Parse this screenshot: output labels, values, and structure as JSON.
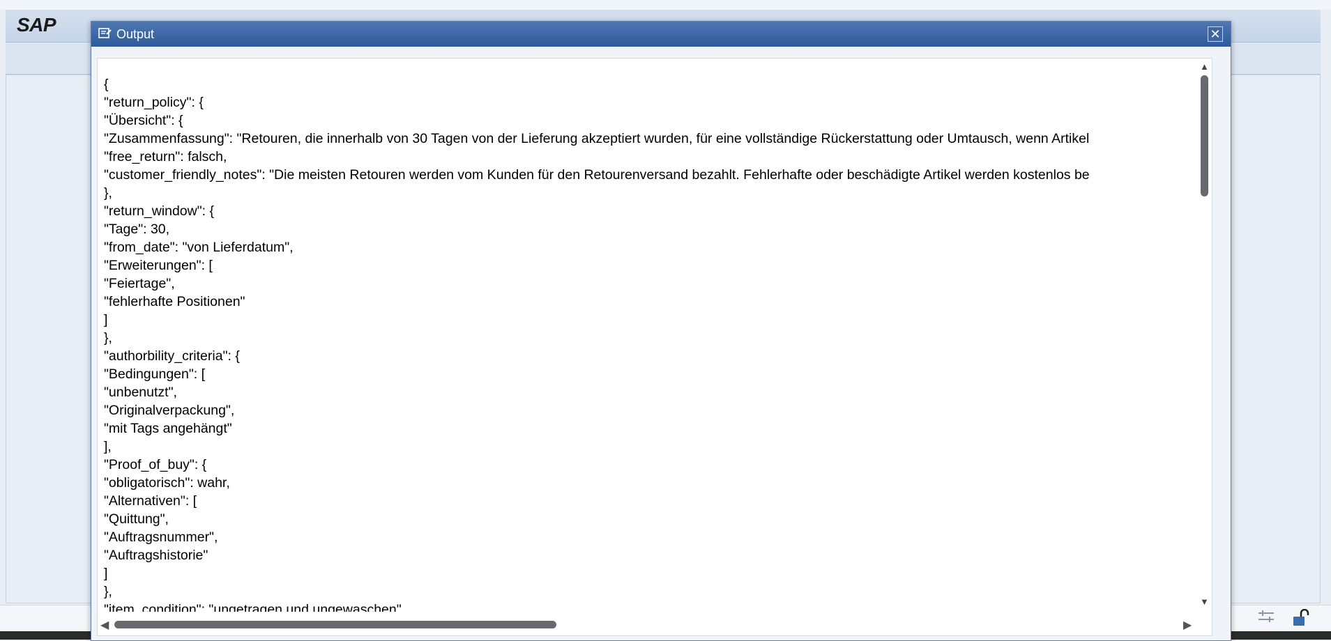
{
  "shell": {
    "logo": "SAP"
  },
  "dialog": {
    "title": "Output",
    "close_label": "✕"
  },
  "output": {
    "lines": [
      "{",
      "\"return_policy\": {",
      "\"Übersicht\": {",
      "\"Zusammenfassung\": \"Retouren, die innerhalb von 30 Tagen von der Lieferung akzeptiert wurden, für eine vollständige Rückerstattung oder Umtausch, wenn Artikel",
      "\"free_return\": falsch,",
      "\"customer_friendly_notes\": \"Die meisten Retouren werden vom Kunden für den Retourenversand bezahlt. Fehlerhafte oder beschädigte Artikel werden kostenlos be",
      "},",
      "\"return_window\": {",
      "\"Tage\": 30,",
      "\"from_date\": \"von Lieferdatum\",",
      "\"Erweiterungen\": [",
      "\"Feiertage\",",
      "\"fehlerhafte Positionen\"",
      "]",
      "},",
      "\"authorbility_criteria\": {",
      "\"Bedingungen\": [",
      "\"unbenutzt\",",
      "\"Originalverpackung\",",
      "\"mit Tags angehängt\"",
      "],",
      "\"Proof_of_buy\": {",
      "\"obligatorisch\": wahr,",
      "\"Alternativen\": [",
      "\"Quittung\",",
      "\"Auftragsnummer\",",
      "\"Auftragshistorie\"",
      "]",
      "},",
      "\"item_condition\": \"ungetragen und ungewaschen\""
    ]
  },
  "colors": {
    "title_bar": "#2e5a9a",
    "scroll_thumb": "#666a70"
  },
  "icons": {
    "title": "output-window-icon",
    "close": "close-icon",
    "status_1": "settings-sliders-icon",
    "status_2": "unlock-icon"
  }
}
